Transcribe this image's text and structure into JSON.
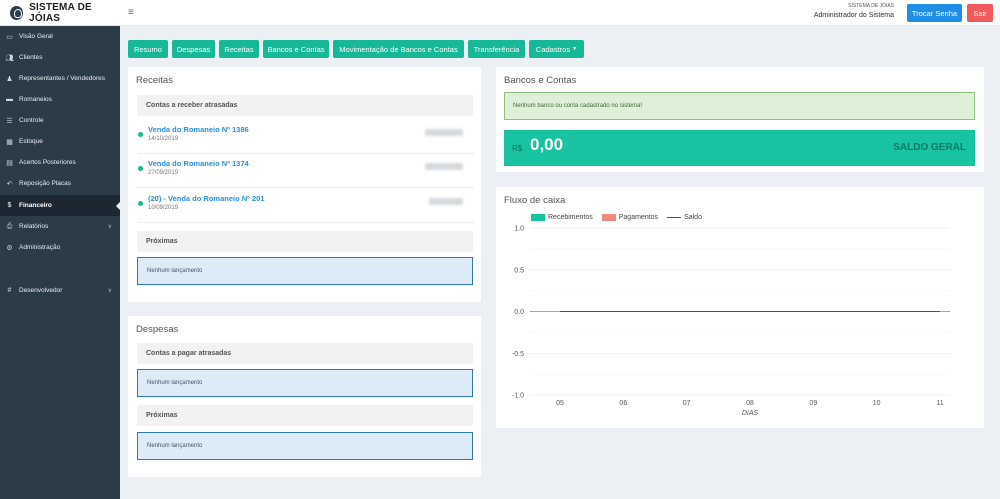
{
  "header": {
    "brand": "SISTEMA DE JÓIAS",
    "menu_icon": "≡",
    "system_name": "SISTEMA DE JÓIAS",
    "user_name": "Administrador do Sistema",
    "change_password_label": "Trocar Senha",
    "logout_label": "Sair"
  },
  "sidebar": {
    "items": [
      {
        "icon": "monitor-icon",
        "label": "Visão Geral"
      },
      {
        "icon": "users-icon",
        "label": "Clientes"
      },
      {
        "icon": "user-tie-icon",
        "label": "Representantes / Vendedores"
      },
      {
        "icon": "briefcase-icon",
        "label": "Romaneios"
      },
      {
        "icon": "list-icon",
        "label": "Controle"
      },
      {
        "icon": "grid-icon",
        "label": "Estoque"
      },
      {
        "icon": "calendar-icon",
        "label": "Acertos Posteriores"
      },
      {
        "icon": "undo-icon",
        "label": "Reposição Placas"
      },
      {
        "icon": "dollar-icon",
        "label": "Financeiro"
      },
      {
        "icon": "print-icon",
        "label": "Relatórios"
      },
      {
        "icon": "gear-icon",
        "label": "Administração"
      },
      {
        "icon": "hash-icon",
        "label": "Desenvolvedor"
      }
    ]
  },
  "tabs": [
    "Resumo",
    "Despesas",
    "Receitas",
    "Bancos e Contas",
    "Movimentação de Bancos e Contas",
    "Transferência",
    "Cadastros"
  ],
  "receitas": {
    "title": "Receitas",
    "overdue_heading": "Contas a receber atrasadas",
    "items": [
      {
        "title": "Venda do Romaneio Nº 1386",
        "date": "14/10/2019"
      },
      {
        "title": "Venda do Romaneio Nº 1374",
        "date": "27/09/2019"
      },
      {
        "title": "(20) - Venda do Romaneio Nº 201",
        "date": "10/09/2019"
      }
    ],
    "upcoming_heading": "Próximas",
    "upcoming_empty": "Nenhum lançamento"
  },
  "despesas": {
    "title": "Despesas",
    "overdue_heading": "Contas a pagar atrasadas",
    "overdue_empty": "Nenhum lançamento",
    "upcoming_heading": "Próximas",
    "upcoming_empty": "Nenhum lançamento"
  },
  "bancos": {
    "title": "Bancos e Contas",
    "empty_message": "Nenhum banco ou conta cadastrado no sistema!",
    "currency": "R$",
    "balance": "0,00",
    "balance_label": "SALDO GERAL"
  },
  "fluxo": {
    "title": "Fluxo de caixa"
  },
  "colors": {
    "accent": "#17b897",
    "recebimentos": "#17c3a0",
    "pagamentos": "#f08a7e",
    "saldo": "#36528a"
  },
  "chart_data": {
    "type": "bar",
    "categories": [
      "05",
      "06",
      "07",
      "08",
      "09",
      "10",
      "11"
    ],
    "series": [
      {
        "name": "Recebimentos",
        "type": "bar",
        "values": [
          0,
          0,
          0,
          0,
          0,
          0,
          0
        ]
      },
      {
        "name": "Pagamentos",
        "type": "bar",
        "values": [
          0,
          0,
          0,
          0,
          0,
          0,
          0
        ]
      },
      {
        "name": "Saldo",
        "type": "line",
        "values": [
          0,
          0,
          0,
          0,
          0,
          0,
          0
        ]
      }
    ],
    "xlabel": "DIAS",
    "ylabel": "",
    "ylim": [
      -1.0,
      1.0
    ],
    "yticks": [
      "1.0",
      "0.5",
      "0.0",
      "-0.5",
      "-1.0"
    ],
    "grid": true,
    "legend_position": "top"
  }
}
